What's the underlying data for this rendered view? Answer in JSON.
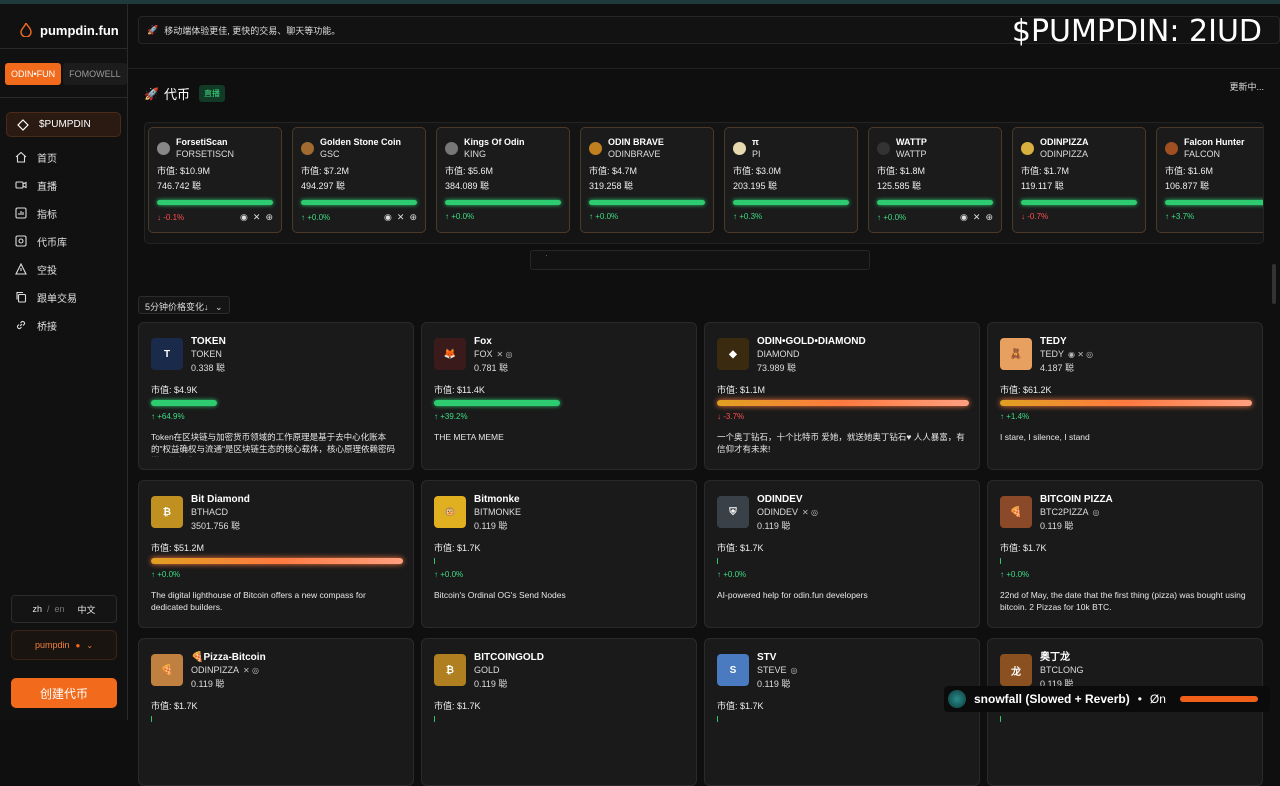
{
  "sidebar": {
    "brand": "pumpdin.fun",
    "tabs": [
      {
        "label": "ODIN•FUN",
        "active": true
      },
      {
        "label": "FOMOWELL",
        "active": false
      }
    ],
    "nav": [
      {
        "label": "$PUMPDIN",
        "icon": "diamond-icon",
        "active": true
      },
      {
        "label": "首页",
        "icon": "home-icon"
      },
      {
        "label": "直播",
        "icon": "video-icon"
      },
      {
        "label": "指标",
        "icon": "chart-icon"
      },
      {
        "label": "代币库",
        "icon": "vault-icon"
      },
      {
        "label": "空投",
        "icon": "airdrop-icon"
      },
      {
        "label": "跟单交易",
        "icon": "copy-icon"
      },
      {
        "label": "桥接",
        "icon": "link-icon"
      }
    ],
    "lang": {
      "zh": "zh",
      "slash": "/",
      "en": "en",
      "zh_cn": "中文"
    },
    "user": "pumpdin",
    "create_label": "创建代币"
  },
  "header": {
    "announcement": "移动端体验更佳, 更快的交易、聊天等功能。",
    "watermark": "$PUMPDIN: 2IUD"
  },
  "ticker_section": {
    "title": "代币",
    "live_badge": "直播",
    "updating": "更新中...",
    "scroll_text": "·"
  },
  "ticker": [
    {
      "name": "ForsetiScan",
      "symbol": "FORSETISCN",
      "mc": "市值: $10.9M",
      "amount": "746.742 聪",
      "change": "-0.1%",
      "dir": "down",
      "socials": true,
      "coin_color": "#888"
    },
    {
      "name": "Golden Stone Coin",
      "symbol": "GSC",
      "mc": "市值: $7.2M",
      "amount": "494.297 聪",
      "change": "+0.0%",
      "dir": "up",
      "socials": true,
      "coin_color": "#a06a30"
    },
    {
      "name": "Kings Of Odin",
      "symbol": "KING",
      "mc": "市值: $5.6M",
      "amount": "384.089 聪",
      "change": "+0.0%",
      "dir": "up",
      "socials": false,
      "coin_color": "#777"
    },
    {
      "name": "ODIN BRAVE",
      "symbol": "ODINBRAVE",
      "mc": "市值: $4.7M",
      "amount": "319.258 聪",
      "change": "+0.0%",
      "dir": "up",
      "socials": false,
      "coin_color": "#c08020"
    },
    {
      "name": "π",
      "symbol": "PI",
      "mc": "市值: $3.0M",
      "amount": "203.195 聪",
      "change": "+0.3%",
      "dir": "up",
      "socials": false,
      "coin_color": "#e8d8b0"
    },
    {
      "name": "WATTP",
      "symbol": "WATTP",
      "mc": "市值: $1.8M",
      "amount": "125.585 聪",
      "change": "+0.0%",
      "dir": "up",
      "socials": true,
      "coin_color": "#333"
    },
    {
      "name": "ODINPIZZA",
      "symbol": "ODINPIZZA",
      "mc": "市值: $1.7M",
      "amount": "119.117 聪",
      "change": "-0.7%",
      "dir": "down",
      "socials": false,
      "coin_color": "#d8b040"
    },
    {
      "name": "Falcon Hunter",
      "symbol": "FALCON",
      "mc": "市值: $1.6M",
      "amount": "106.877 聪",
      "change": "+3.7%",
      "dir": "up",
      "socials": false,
      "coin_color": "#a05020"
    }
  ],
  "sort_label": "5分钟价格变化↓",
  "cards": [
    {
      "name": "TOKEN",
      "symbol": "TOKEN",
      "badges": "",
      "amount": "0.338 聪",
      "mc": "市值: $4.9K",
      "bar": 0.26,
      "bar_style": "green",
      "change": "+64.9%",
      "dir": "up",
      "desc": "Token在区块链与加密货币领域的工作原理是基于去中心化账本的\"权益确权与流通\"是区块链生态的核心载体，核心原理依赖密码学、分布式...",
      "icon_bg": "#1a2a4a",
      "icon_text": "T"
    },
    {
      "name": "Fox",
      "symbol": "FOX",
      "badges": "✕ ◎",
      "amount": "0.781 聪",
      "mc": "市值: $11.4K",
      "bar": 0.5,
      "bar_style": "green",
      "change": "+39.2%",
      "dir": "up",
      "desc": "THE META MEME",
      "icon_bg": "#3a1a1a",
      "icon_text": "🦊"
    },
    {
      "name": "ODIN•GOLD•DIAMOND",
      "symbol": "DIAMOND",
      "badges": "",
      "amount": "73.989 聪",
      "mc": "市值: $1.1M",
      "bar": 1.0,
      "bar_style": "grad",
      "change": "-3.7%",
      "dir": "down",
      "desc": "一个奥丁钻石，十个比特币 爱她，就送她奥丁钻石♥ 人人暴富，有信仰才有未来!",
      "icon_bg": "#3a2a10",
      "icon_text": "◆"
    },
    {
      "name": "TEDY",
      "symbol": "TEDY",
      "badges": "◉ ✕ ◎",
      "amount": "4.187 聪",
      "mc": "市值: $61.2K",
      "bar": 1.0,
      "bar_style": "grad",
      "change": "+1.4%",
      "dir": "up",
      "desc": "I stare, I silence, I stand",
      "icon_bg": "#e8a060",
      "icon_text": "🧸"
    },
    {
      "name": "Bit Diamond",
      "symbol": "BTHACD",
      "badges": "",
      "amount": "3501.756 聪",
      "mc": "市值: $51.2M",
      "bar": 1.0,
      "bar_style": "grad",
      "change": "+0.0%",
      "dir": "up",
      "desc": "The digital lighthouse of Bitcoin offers a new compass for dedicated builders.",
      "icon_bg": "#c09020",
      "icon_text": "₿"
    },
    {
      "name": "Bitmonke",
      "symbol": "BITMONKE",
      "badges": "",
      "amount": "0.119 聪",
      "mc": "市值: $1.7K",
      "bar": 0.0,
      "bar_style": "tiny",
      "change": "+0.0%",
      "dir": "up",
      "desc": "Bitcoin's Ordinal OG's Send Nodes",
      "icon_bg": "#e0b020",
      "icon_text": "🐵"
    },
    {
      "name": "ODINDEV",
      "symbol": "ODINDEV",
      "badges": "✕ ◎",
      "amount": "0.119 聪",
      "mc": "市值: $1.7K",
      "bar": 0.0,
      "bar_style": "tiny",
      "change": "+0.0%",
      "dir": "up",
      "desc": "AI-powered help for odin.fun developers",
      "icon_bg": "#3a4048",
      "icon_text": "⛨"
    },
    {
      "name": "BITCOIN PIZZA",
      "symbol": "BTC2PIZZA",
      "badges": "◎",
      "amount": "0.119 聪",
      "mc": "市值: $1.7K",
      "bar": 0.0,
      "bar_style": "tiny",
      "change": "+0.0%",
      "dir": "up",
      "desc": "22nd of May, the date that the first thing (pizza) was bought using bitcoin. 2 Pizzas for 10k BTC.",
      "icon_bg": "#8a4a2a",
      "icon_text": "🍕"
    },
    {
      "name": "🍕Pizza-Bitcoin",
      "symbol": "ODINPIZZA",
      "badges": "✕ ◎",
      "amount": "0.119 聪",
      "mc": "市值: $1.7K",
      "bar": 0.0,
      "bar_style": "tiny",
      "change": "",
      "dir": "up",
      "desc": "",
      "icon_bg": "#c08040",
      "icon_text": "🍕"
    },
    {
      "name": "BITCOINGOLD",
      "symbol": "GOLD",
      "badges": "",
      "amount": "0.119 聪",
      "mc": "市值: $1.7K",
      "bar": 0.0,
      "bar_style": "tiny",
      "change": "",
      "dir": "up",
      "desc": "",
      "icon_bg": "#b08020",
      "icon_text": "₿"
    },
    {
      "name": "STV",
      "symbol": "STEVE",
      "badges": "◎",
      "amount": "0.119 聪",
      "mc": "市值: $1.7K",
      "bar": 0.0,
      "bar_style": "tiny",
      "change": "",
      "dir": "up",
      "desc": "",
      "icon_bg": "#4a7ac0",
      "icon_text": "S"
    },
    {
      "name": "奥丁龙",
      "symbol": "BTCLONG",
      "badges": "",
      "amount": "0.119 聪",
      "mc": "市值: $1.7K",
      "bar": 0.0,
      "bar_style": "tiny",
      "change": "",
      "dir": "up",
      "desc": "",
      "icon_bg": "#8a5020",
      "icon_text": "龙"
    }
  ],
  "player": {
    "title": "snowfall (Slowed + Reverb)",
    "dot": "•",
    "artist": "Øn"
  },
  "colors": {
    "accent": "#f26a1b",
    "up": "#3ddc84",
    "down": "#ff4d4d"
  }
}
